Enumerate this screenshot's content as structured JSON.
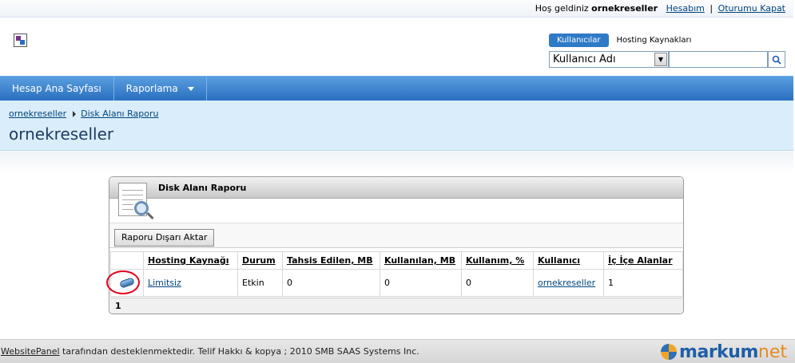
{
  "top": {
    "welcome_prefix": "Hoş geldiniz",
    "username": "ornekreseller",
    "account_link": "Hesabım",
    "separator": "|",
    "logout_link": "Oturumu Kapat"
  },
  "search": {
    "tab_active": "Kullanıcılar",
    "tab_other": "Hosting Kaynakları",
    "select_value": "Kullanıcı Adı",
    "input_value": ""
  },
  "nav": {
    "items": [
      {
        "label": "Hesap Ana Sayfası"
      },
      {
        "label": "Raporlama"
      }
    ]
  },
  "breadcrumb": {
    "items": [
      {
        "label": "ornekreseller"
      },
      {
        "label": "Disk Alanı Raporu"
      }
    ]
  },
  "page": {
    "title": "ornekreseller"
  },
  "panel": {
    "title": "Disk Alanı Raporu",
    "export_button": "Raporu Dışarı Aktar"
  },
  "table": {
    "columns": [
      "",
      "Hosting Kaynağı",
      "Durum",
      "Tahsis Edilen, MB",
      "Kullanılan, MB",
      "Kullanım, %",
      "Kullanıcı",
      "İç İçe Alanlar"
    ],
    "rows": [
      {
        "icon": "disk-space-icon",
        "hosting": "Limitsiz",
        "status": "Etkin",
        "allocated": "0",
        "used": "0",
        "usage_pct": "0",
        "user": "ornekreseller",
        "nested": "1"
      }
    ],
    "pager": "1"
  },
  "footer": {
    "link": "WebsitePanel",
    "text": " tarafından desteklenmektedir. Telif Hakkı & kopya ; 2010 SMB SAAS Systems Inc.",
    "brand_main": "markum",
    "brand_suffix": "net"
  }
}
